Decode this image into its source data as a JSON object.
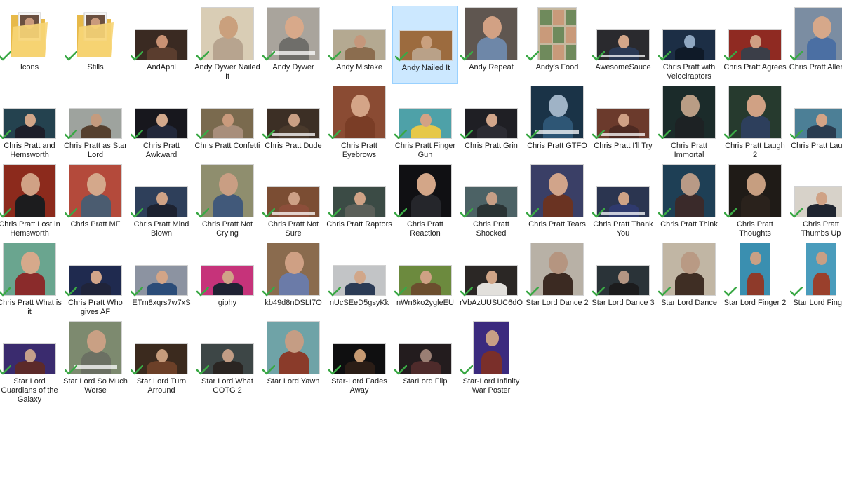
{
  "explorer": {
    "items": [
      {
        "name": "Icons",
        "type": "folder",
        "thumb": "folder",
        "synced": true
      },
      {
        "name": "Stills",
        "type": "folder",
        "thumb": "folder",
        "synced": true
      },
      {
        "name": "AndApril",
        "type": "image",
        "thumb": "wide",
        "bg": "#3a2a22",
        "face": "#c99274",
        "shirt": "#5a3d2e",
        "synced": true
      },
      {
        "name": "Andy Dywer Nailed It",
        "type": "image",
        "thumb": "tall",
        "bg": "#d9cdb5",
        "face": "#caa07d",
        "shirt": "#b7a48f",
        "synced": true
      },
      {
        "name": "Andy Dywer",
        "type": "image",
        "thumb": "tall",
        "bg": "#a9a49c",
        "face": "#d8a98a",
        "shirt": "#6f6e6a",
        "caption": true,
        "synced": true
      },
      {
        "name": "Andy Mistake",
        "type": "image",
        "thumb": "wide",
        "bg": "#b4a991",
        "face": "#c5977b",
        "shirt": "#8b6d4f",
        "synced": true
      },
      {
        "name": "Andy Nailed It",
        "type": "image",
        "thumb": "wide",
        "bg": "#9c6b3e",
        "face": "#c9a07e",
        "shirt": "#b9a188",
        "synced": true,
        "selected": true
      },
      {
        "name": "Andy Repeat",
        "type": "image",
        "thumb": "tall",
        "bg": "#5f5650",
        "face": "#d2a184",
        "shirt": "#6e87a8",
        "synced": true
      },
      {
        "name": "Andy's Food",
        "type": "image",
        "thumb": "grid",
        "bg": "#c5b89f",
        "face": "#c99a7a",
        "shirt": "#6f8a5c",
        "synced": true
      },
      {
        "name": "AwesomeSauce",
        "type": "image",
        "thumb": "wide",
        "bg": "#2a2a2e",
        "face": "#d3a689",
        "shirt": "#2b3a55",
        "caption": true,
        "synced": true
      },
      {
        "name": "Chris Pratt with Velociraptors",
        "type": "image",
        "thumb": "wide",
        "bg": "#1c2e45",
        "face": "#8fa7c1",
        "shirt": "#0f1a28",
        "synced": true
      },
      {
        "name": "Chris Pratt Agrees",
        "type": "image",
        "thumb": "wide",
        "bg": "#8f2a22",
        "face": "#cf9f83",
        "shirt": "#3b3e48",
        "synced": true
      },
      {
        "name": "Chris Pratt Allergic",
        "type": "image",
        "thumb": "tall",
        "bg": "#7b8da2",
        "face": "#d6a88a",
        "shirt": "#4b6fa3",
        "synced": true
      },
      {
        "name": "Chris Pratt and Hemsworth",
        "type": "image",
        "thumb": "wide",
        "bg": "#24424f",
        "face": "#d1a689",
        "shirt": "#1d1f2a",
        "synced": true
      },
      {
        "name": "Chris Pratt as Star Lord",
        "type": "image",
        "thumb": "wide",
        "bg": "#9ea39e",
        "face": "#c49b7e",
        "shirt": "#55402f",
        "synced": true
      },
      {
        "name": "Chris Pratt Awkward",
        "type": "image",
        "thumb": "wide",
        "bg": "#17171d",
        "face": "#d3a98c",
        "shirt": "#22283a",
        "synced": true
      },
      {
        "name": "Chris Pratt Confetti",
        "type": "image",
        "thumb": "wide",
        "bg": "#7a6a4e",
        "face": "#c99a7c",
        "shirt": "#a88e7b",
        "synced": true
      },
      {
        "name": "Chris Pratt Dude",
        "type": "image",
        "thumb": "wide",
        "bg": "#3c2f25",
        "face": "#caa084",
        "shirt": "#4a3a2c",
        "caption": true,
        "synced": true
      },
      {
        "name": "Chris Pratt Eyebrows",
        "type": "image",
        "thumb": "tall",
        "bg": "#8a4b33",
        "face": "#d4a487",
        "shirt": "#7a3d26",
        "synced": true
      },
      {
        "name": "Chris Pratt Finger Gun",
        "type": "image",
        "thumb": "wide",
        "bg": "#4ea1a8",
        "face": "#d3a285",
        "shirt": "#e6c84a",
        "synced": true
      },
      {
        "name": "Chris Pratt Grin",
        "type": "image",
        "thumb": "wide",
        "bg": "#1f1f24",
        "face": "#d2a68a",
        "shirt": "#2c2c33",
        "synced": true
      },
      {
        "name": "Chris Pratt GTFO",
        "type": "image",
        "thumb": "tall",
        "bg": "#1a3347",
        "face": "#9fb3c6",
        "shirt": "#2e5675",
        "caption": true,
        "synced": true
      },
      {
        "name": "Chris Pratt I'll Try",
        "type": "image",
        "thumb": "wide",
        "bg": "#6b3a2c",
        "face": "#cfa085",
        "shirt": "#4e2a22",
        "caption": true,
        "synced": true
      },
      {
        "name": "Chris Pratt Immortal",
        "type": "image",
        "thumb": "tall",
        "bg": "#1b2b2a",
        "face": "#b99d85",
        "shirt": "#1d2224",
        "synced": true
      },
      {
        "name": "Chris Pratt Laugh 2",
        "type": "image",
        "thumb": "tall",
        "bg": "#263a2e",
        "face": "#d0a184",
        "shirt": "#2d3f5c",
        "synced": true
      },
      {
        "name": "Chris Pratt Laugh",
        "type": "image",
        "thumb": "wide",
        "bg": "#4c7f96",
        "face": "#d4a486",
        "shirt": "#2a3c4f",
        "synced": true
      },
      {
        "name": "Chris Pratt Lost in Hemsworth",
        "type": "image",
        "thumb": "tall",
        "bg": "#8c2a1c",
        "face": "#d0a185",
        "shirt": "#1c1c1e",
        "synced": true
      },
      {
        "name": "Chris Pratt MF",
        "type": "image",
        "thumb": "tall",
        "bg": "#b44a3b",
        "face": "#d4a88b",
        "shirt": "#4b5c70",
        "synced": true
      },
      {
        "name": "Chris Pratt Mind Blown",
        "type": "image",
        "thumb": "wide",
        "bg": "#2e3f5a",
        "face": "#d0a386",
        "shirt": "#1d2230",
        "synced": true
      },
      {
        "name": "Chris Pratt Not Crying",
        "type": "image",
        "thumb": "tall",
        "bg": "#8f8e6e",
        "face": "#c99e83",
        "shirt": "#41597a",
        "synced": true
      },
      {
        "name": "Chris Pratt Not Sure",
        "type": "image",
        "thumb": "wide",
        "bg": "#7b4d33",
        "face": "#cda086",
        "shirt": "#8c4e3a",
        "caption": true,
        "synced": true
      },
      {
        "name": "Chris Pratt Raptors",
        "type": "image",
        "thumb": "wide",
        "bg": "#3b4b45",
        "face": "#d0a386",
        "shirt": "#5b5f59",
        "synced": true
      },
      {
        "name": "Chris Pratt Reaction",
        "type": "image",
        "thumb": "tall",
        "bg": "#101013",
        "face": "#d3a688",
        "shirt": "#25262b",
        "synced": true
      },
      {
        "name": "Chris Pratt Shocked",
        "type": "image",
        "thumb": "wide",
        "bg": "#4c6265",
        "face": "#c79f86",
        "shirt": "#2a3334",
        "synced": true
      },
      {
        "name": "Chris Pratt Tears",
        "type": "image",
        "thumb": "tall",
        "bg": "#3a3f66",
        "face": "#d1a48a",
        "shirt": "#6a3322",
        "synced": true
      },
      {
        "name": "Chris Pratt Thank You",
        "type": "image",
        "thumb": "wide",
        "bg": "#2b3550",
        "face": "#cfa386",
        "shirt": "#2f3a6e",
        "caption": true,
        "synced": true
      },
      {
        "name": "Chris Pratt Think",
        "type": "image",
        "thumb": "tall",
        "bg": "#1e3f55",
        "face": "#b89a86",
        "shirt": "#3a2a2a",
        "synced": true
      },
      {
        "name": "Chris Pratt Thoughts",
        "type": "image",
        "thumb": "tall",
        "bg": "#1f1b17",
        "face": "#c69e80",
        "shirt": "#2a221c",
        "synced": true
      },
      {
        "name": "Chris Pratt Thumbs Up",
        "type": "image",
        "thumb": "wide",
        "bg": "#d7d2c9",
        "face": "#cfa285",
        "shirt": "#1f2530",
        "synced": true
      },
      {
        "name": "Chris Pratt What is it",
        "type": "image",
        "thumb": "tall",
        "bg": "#6aa58f",
        "face": "#d6a98b",
        "shirt": "#8a2b2b",
        "synced": true
      },
      {
        "name": "Chris Pratt Who gives AF",
        "type": "image",
        "thumb": "wide",
        "bg": "#1f2a4f",
        "face": "#d3a68a",
        "shirt": "#20243a",
        "synced": true
      },
      {
        "name": "ETm8xqrs7w7xS",
        "type": "image",
        "thumb": "wide",
        "bg": "#8c93a1",
        "face": "#d3a587",
        "shirt": "#2b4c78",
        "synced": true
      },
      {
        "name": "giphy",
        "type": "image",
        "thumb": "wide",
        "bg": "#c6337a",
        "face": "#d0a387",
        "shirt": "#1f2233",
        "synced": true
      },
      {
        "name": "kb49d8nDSLI7O",
        "type": "image",
        "thumb": "tall",
        "bg": "#8a6b4e",
        "face": "#cfa084",
        "shirt": "#6b7ba8",
        "synced": true
      },
      {
        "name": "nUcSEeD5gsyKk",
        "type": "image",
        "thumb": "wide",
        "bg": "#c2c4c6",
        "face": "#d1a78a",
        "shirt": "#2b3b55",
        "synced": true
      },
      {
        "name": "nWn6ko2ygleEU",
        "type": "image",
        "thumb": "wide",
        "bg": "#6c8a3e",
        "face": "#cfa184",
        "shirt": "#6b4e2e",
        "synced": true
      },
      {
        "name": "rVbAzUUSUC6dO",
        "type": "image",
        "thumb": "wide",
        "bg": "#2b2725",
        "face": "#d0a587",
        "shirt": "#e2e0dc",
        "synced": true
      },
      {
        "name": "Star Lord Dance 2",
        "type": "image",
        "thumb": "tall",
        "bg": "#b8b1a6",
        "face": "#b59580",
        "shirt": "#3b2a22",
        "synced": true
      },
      {
        "name": "Star Lord Dance 3",
        "type": "image",
        "thumb": "wide",
        "bg": "#2a3338",
        "face": "#b49683",
        "shirt": "#1c1c1d",
        "synced": true
      },
      {
        "name": "Star Lord Dance",
        "type": "image",
        "thumb": "tall",
        "bg": "#c1b6a4",
        "face": "#b99a84",
        "shirt": "#3f2e24",
        "synced": true
      },
      {
        "name": "Star Lord Finger 2",
        "type": "image",
        "thumb": "tallnarrow",
        "bg": "#3a8fb0",
        "face": "#c8a085",
        "shirt": "#8e3a2a",
        "synced": true
      },
      {
        "name": "Star Lord Finger",
        "type": "image",
        "thumb": "tallnarrow",
        "bg": "#4a9cbc",
        "face": "#c89f85",
        "shirt": "#9a402c",
        "synced": true
      },
      {
        "name": "Star Lord Guardians of the Galaxy",
        "type": "image",
        "thumb": "wide",
        "bg": "#3a2b6e",
        "face": "#c6a08a",
        "shirt": "#5c2a2a",
        "synced": true
      },
      {
        "name": "Star Lord So Much Worse",
        "type": "image",
        "thumb": "tall",
        "bg": "#7d8a6f",
        "face": "#c9a084",
        "shirt": "#6b7063",
        "caption": true,
        "synced": true
      },
      {
        "name": "Star Lord Turn Arround",
        "type": "image",
        "thumb": "wide",
        "bg": "#3b2a1e",
        "face": "#c69c7c",
        "shirt": "#6c4028",
        "synced": true
      },
      {
        "name": "Star Lord What GOTG 2",
        "type": "image",
        "thumb": "wide",
        "bg": "#3d4646",
        "face": "#c29d85",
        "shirt": "#2a2522",
        "synced": true
      },
      {
        "name": "Star Lord Yawn",
        "type": "image",
        "thumb": "tall",
        "bg": "#6fa3a7",
        "face": "#c59d84",
        "shirt": "#8a3b2a",
        "synced": true
      },
      {
        "name": "Star-Lord Fades Away",
        "type": "image",
        "thumb": "wide",
        "bg": "#0f0f10",
        "face": "#c69a72",
        "shirt": "#2a1d16",
        "synced": true
      },
      {
        "name": "StarLord Flip",
        "type": "image",
        "thumb": "wide",
        "bg": "#231c1e",
        "face": "#9a7f74",
        "shirt": "#4e2b2b",
        "synced": true
      },
      {
        "name": "Star-Lord Infinity War Poster",
        "type": "image",
        "thumb": "poster",
        "bg": "#3b2a7e",
        "face": "#c79f85",
        "shirt": "#7a2f2a",
        "synced": true
      }
    ]
  }
}
